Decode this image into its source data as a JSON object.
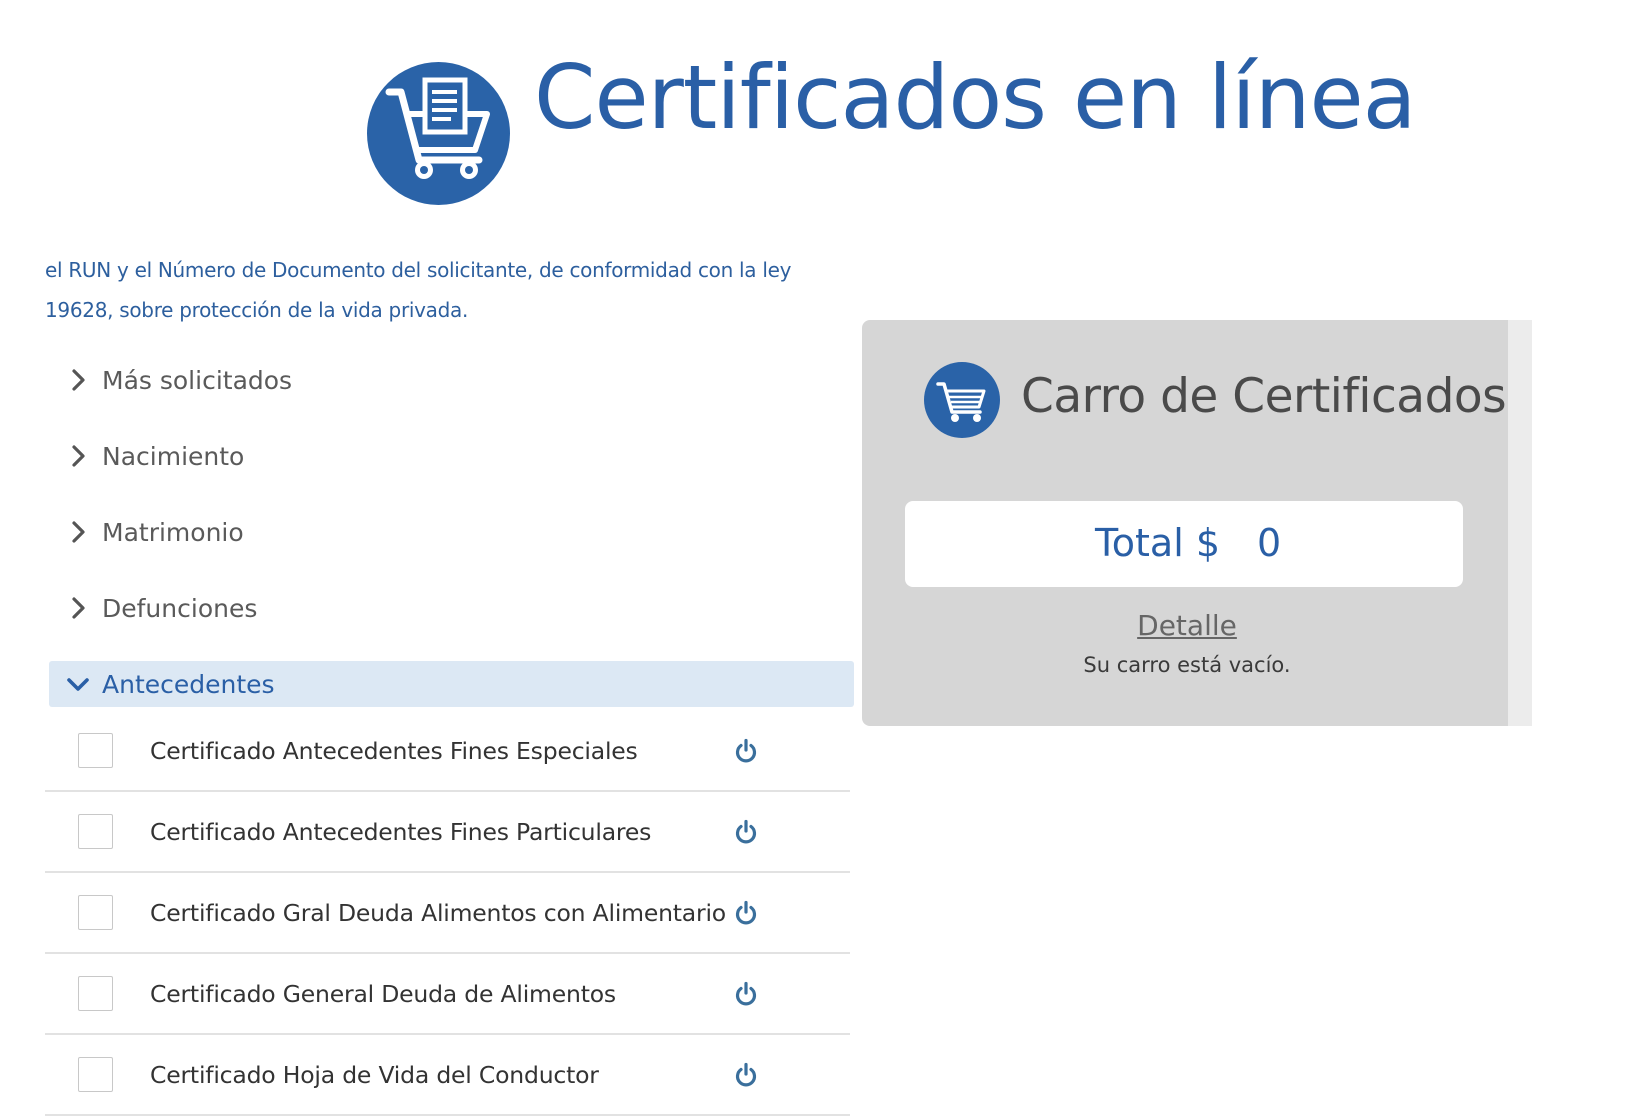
{
  "header": {
    "logo_icon": "cart-document-icon",
    "title": "Certificados en línea"
  },
  "intro": {
    "text_line1": "el RUN y el Número de Documento del solicitante, de conformidad con la ley",
    "text_line2": "19628, sobre protección de la vida privada."
  },
  "categories": [
    {
      "label": "Más solicitados",
      "expanded": false
    },
    {
      "label": "Nacimiento",
      "expanded": false
    },
    {
      "label": "Matrimonio",
      "expanded": false
    },
    {
      "label": "Defunciones",
      "expanded": false
    },
    {
      "label": "Antecedentes",
      "expanded": true
    }
  ],
  "certificates": [
    {
      "label": "Certificado Antecedentes Fines Especiales",
      "checked": false,
      "icon": "power-icon"
    },
    {
      "label": "Certificado Antecedentes Fines Particulares",
      "checked": false,
      "icon": "power-icon"
    },
    {
      "label": "Certificado Gral Deuda Alimentos con Alimentario",
      "checked": false,
      "icon": "power-icon"
    },
    {
      "label": "Certificado General Deuda de Alimentos",
      "checked": false,
      "icon": "power-icon"
    },
    {
      "label": "Certificado Hoja de Vida del Conductor",
      "checked": false,
      "icon": "power-icon"
    }
  ],
  "cart": {
    "icon": "cart-icon",
    "title": "Carro de Certificados",
    "total_label": "Total $",
    "total_value": "0",
    "detail_link": "Detalle",
    "empty_message": "Su carro está vacío."
  },
  "colors": {
    "brand_blue": "#2a5fa6",
    "active_category_bg": "#dce8f4",
    "cart_panel_bg": "#d6d6d6"
  }
}
